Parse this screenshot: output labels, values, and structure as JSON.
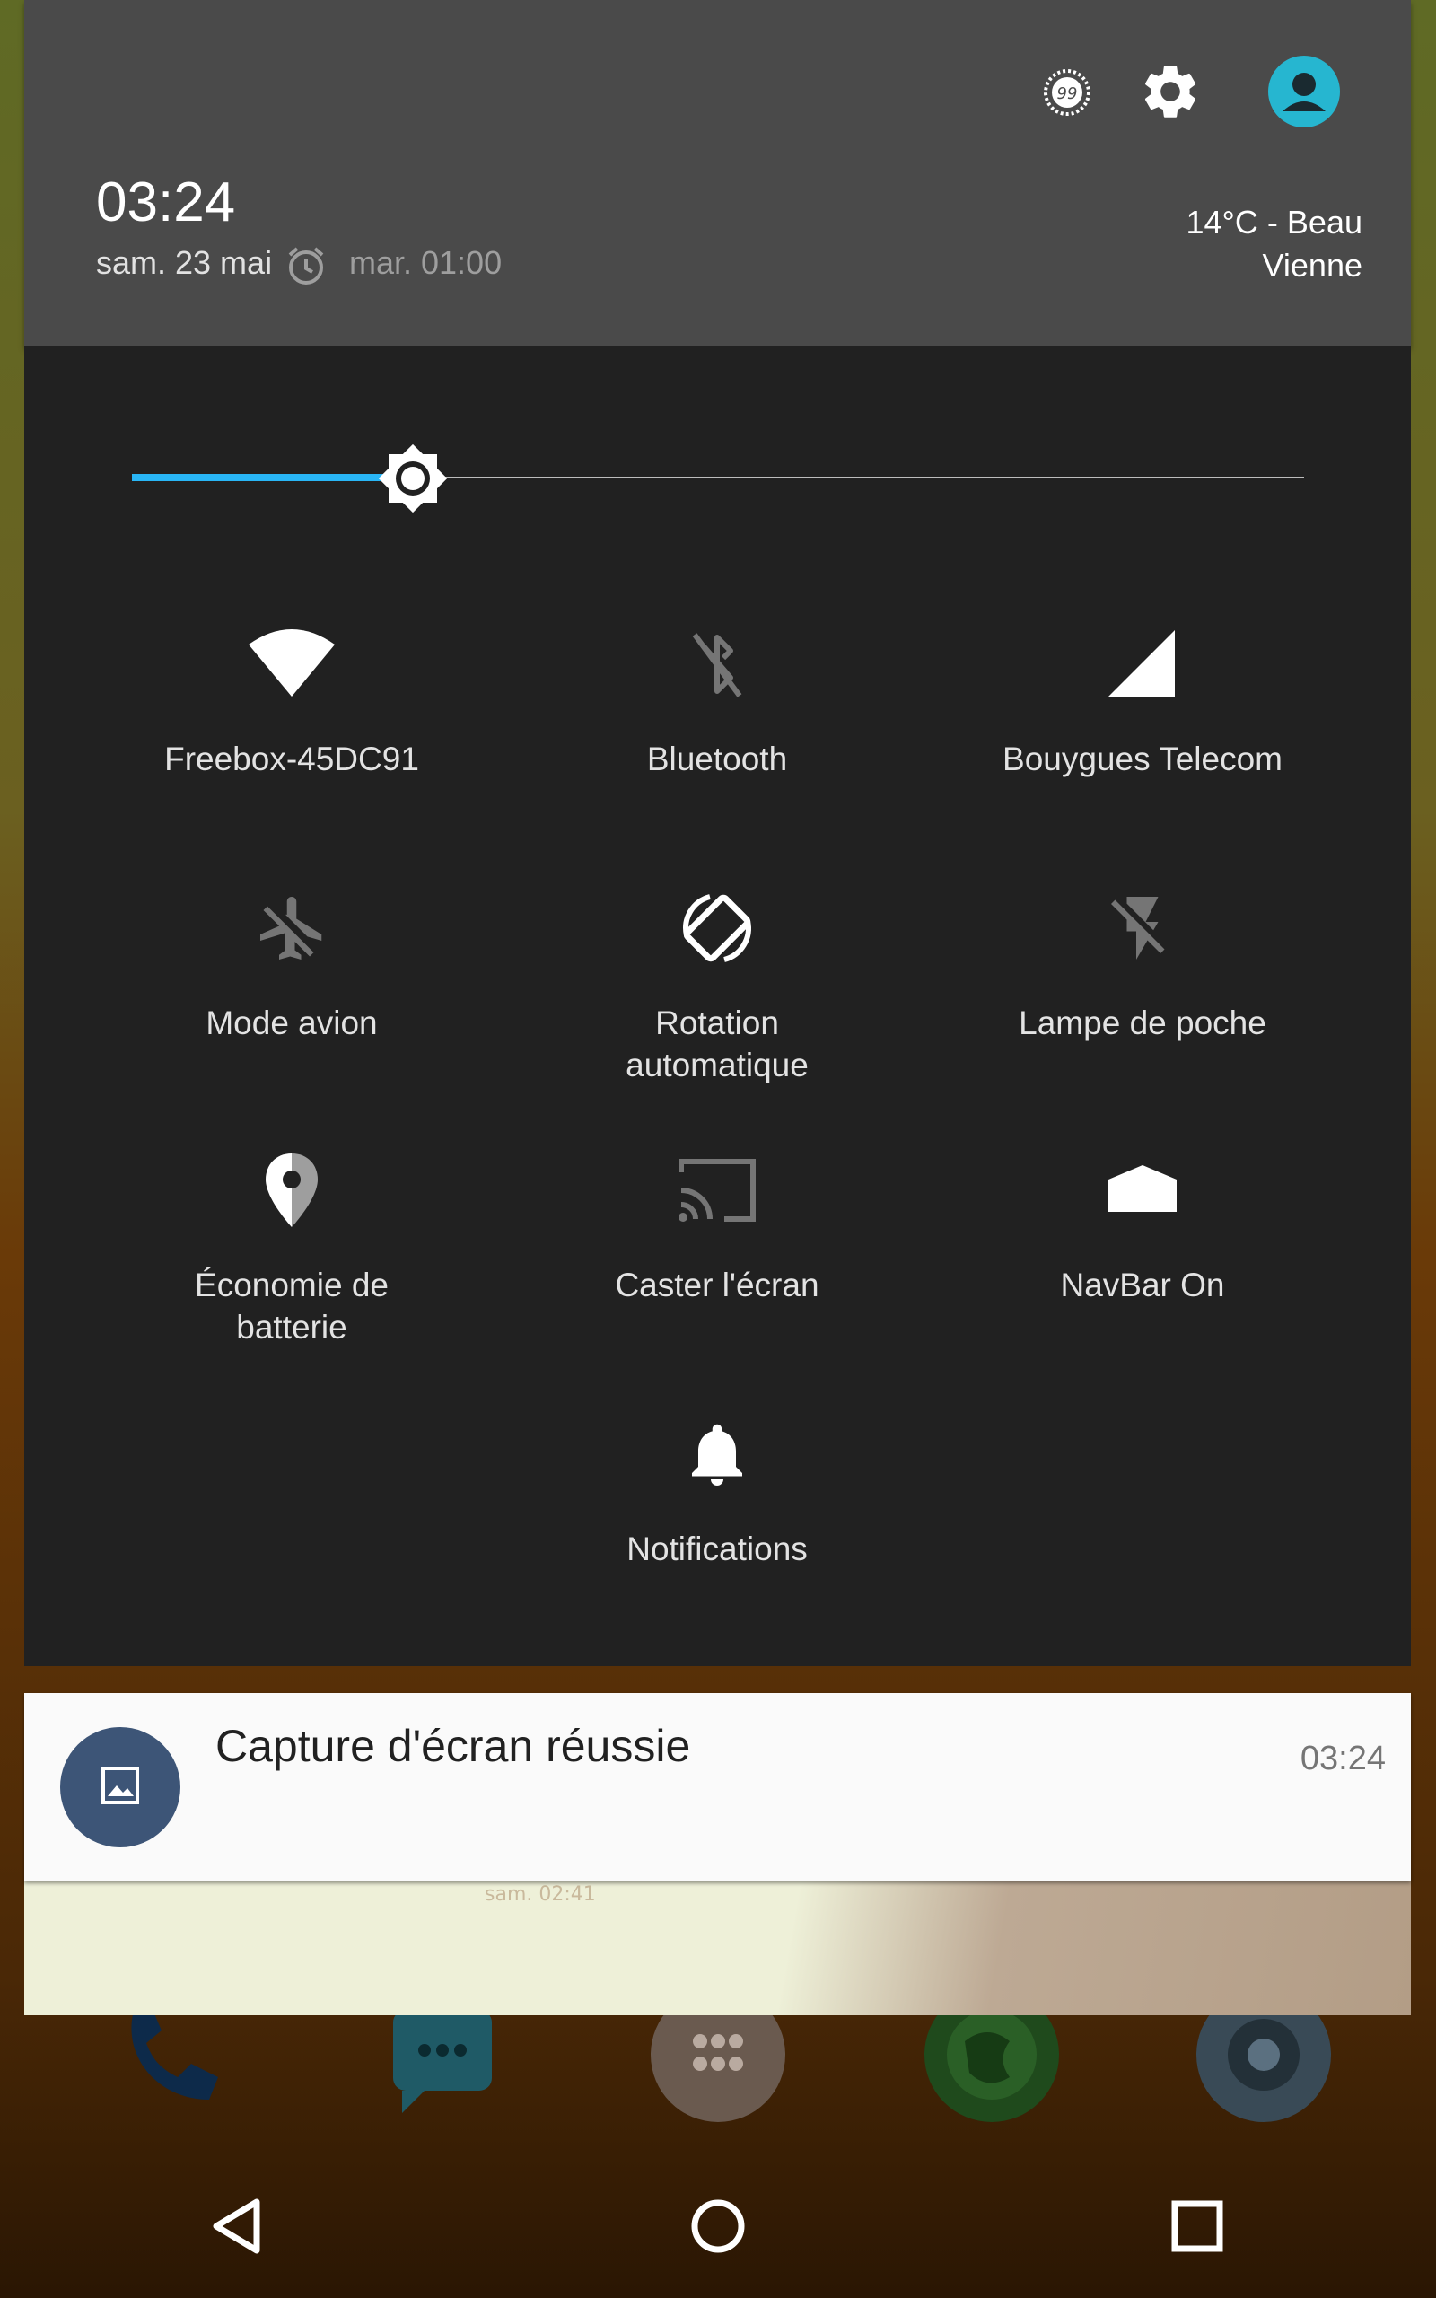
{
  "header": {
    "time": "03:24",
    "date": "sam. 23 mai",
    "next_alarm": "mar. 01:00",
    "weather_line1": "14°C - Beau",
    "weather_line2": "Vienne",
    "icons": [
      "data-saver-icon",
      "gear-icon",
      "user-avatar-icon"
    ]
  },
  "brightness": {
    "level": 0.24,
    "accent": "#29b6f6"
  },
  "tiles": [
    {
      "label": "Freebox-45DC91",
      "icon": "wifi-icon",
      "active": true
    },
    {
      "label": "Bluetooth",
      "icon": "bluetooth-off-icon",
      "active": false
    },
    {
      "label": "Bouygues Telecom",
      "icon": "cell-signal-icon",
      "active": true
    },
    {
      "label": "Mode avion",
      "icon": "airplane-off-icon",
      "active": false
    },
    {
      "label": "Rotation automatique",
      "icon": "auto-rotate-icon",
      "active": true
    },
    {
      "label": "Lampe de poche",
      "icon": "flashlight-off-icon",
      "active": false
    },
    {
      "label": "Économie de batterie",
      "icon": "location-icon",
      "active": true
    },
    {
      "label": "Caster l'écran",
      "icon": "cast-icon",
      "active": false
    },
    {
      "label": "NavBar On",
      "icon": "navbar-icon",
      "active": true
    },
    {
      "label": "Notifications",
      "icon": "bell-icon",
      "active": true
    }
  ],
  "notification": {
    "title": "Capture d'écran réussie",
    "time": "03:24",
    "icon": "image-icon",
    "avatar_color": "#3d5577"
  },
  "background": {
    "preview_text": "sam. 02:41",
    "dock_icons": [
      "phone-icon",
      "messages-icon",
      "apps-drawer-icon",
      "browser-icon",
      "camera-icon"
    ]
  },
  "navbar": {
    "buttons": [
      "back-button",
      "home-button",
      "recents-button"
    ]
  }
}
